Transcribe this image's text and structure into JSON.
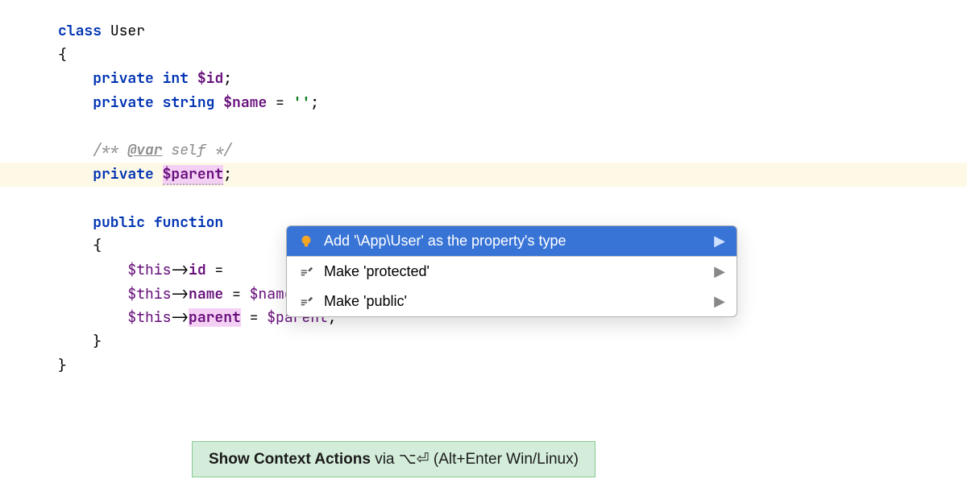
{
  "code": {
    "class_kw": "class",
    "class_name": "User",
    "open_brace": "{",
    "close_brace": "}",
    "private_kw": "private",
    "public_kw": "public",
    "int_type": "int",
    "string_type": "string",
    "function_kw": "function",
    "id_var": "$id",
    "name_var": "$name",
    "parent_var": "$parent",
    "this_var": "$this",
    "id_prop": "id",
    "name_prop": "name",
    "parent_prop": "parent",
    "empty_string": "''",
    "equals": " = ",
    "semicolon": ";",
    "arrow": "->",
    "var_tag": "@var",
    "comment_open": "/** ",
    "comment_self": " self ",
    "comment_close": "*/"
  },
  "popup": {
    "items": [
      {
        "icon": "bulb",
        "label": "Add '\\App\\User' as the property's type",
        "selected": true
      },
      {
        "icon": "pencil",
        "label": "Make 'protected'",
        "selected": false
      },
      {
        "icon": "pencil",
        "label": "Make 'public'",
        "selected": false
      }
    ]
  },
  "hint": {
    "bold": "Show Context Actions",
    "via": " via ",
    "mac_shortcut": "⌥⏎",
    "suffix": " (Alt+Enter Win/Linux)"
  }
}
